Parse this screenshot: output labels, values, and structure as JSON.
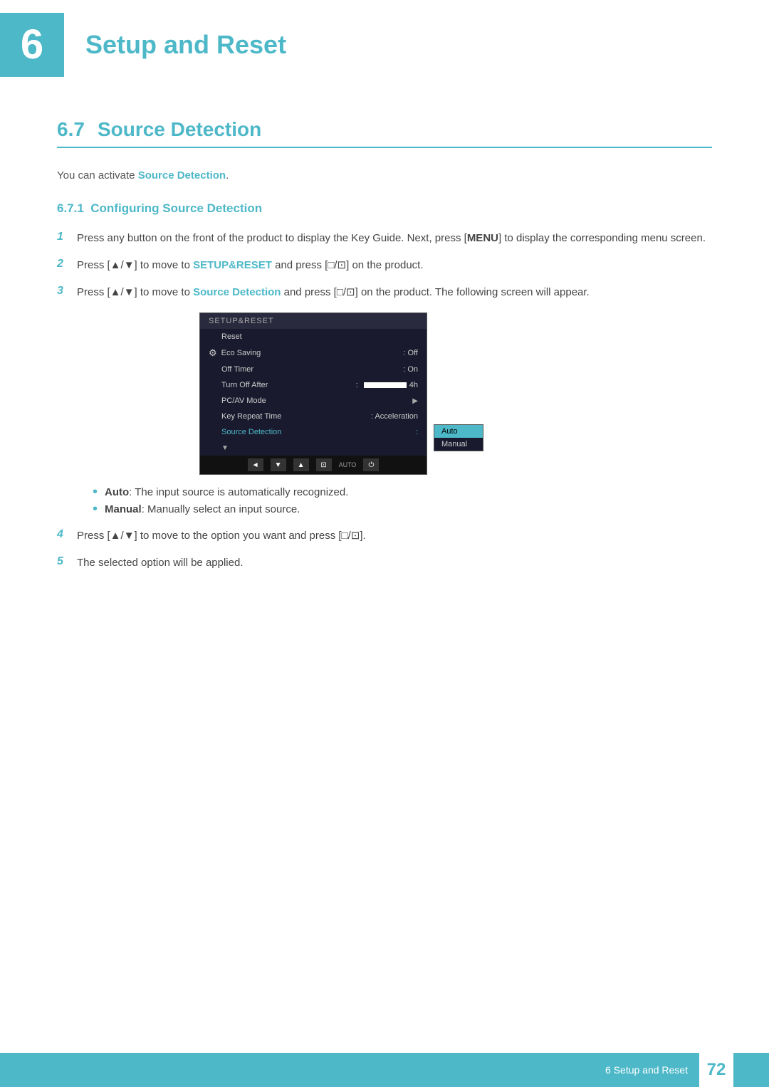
{
  "chapter": {
    "number": "6",
    "title": "Setup and Reset"
  },
  "section": {
    "number": "6.7",
    "title": "Source Detection"
  },
  "intro": {
    "prefix": "You can activate ",
    "highlight": "Source Detection",
    "suffix": "."
  },
  "subsection": {
    "number": "6.7.1",
    "title": "Configuring Source Detection"
  },
  "steps": [
    {
      "number": "1",
      "text_parts": [
        {
          "text": "Press any button on the front of the product to display the Key Guide. Next, press [",
          "type": "normal"
        },
        {
          "text": "MENU",
          "type": "bold"
        },
        {
          "text": "] to display the corresponding menu screen.",
          "type": "normal"
        }
      ]
    },
    {
      "number": "2",
      "text_parts": [
        {
          "text": "Press [▲/▼] to move to ",
          "type": "normal"
        },
        {
          "text": "SETUP&RESET",
          "type": "teal-bold"
        },
        {
          "text": " and press [□/⊡] on the product.",
          "type": "normal"
        }
      ]
    },
    {
      "number": "3",
      "text_parts": [
        {
          "text": "Press [▲/▼] to move to ",
          "type": "normal"
        },
        {
          "text": "Source Detection",
          "type": "teal-bold"
        },
        {
          "text": " and press [□/⊡] on the product. The following screen will appear.",
          "type": "normal"
        }
      ]
    }
  ],
  "menu": {
    "title": "SETUP&RESET",
    "items": [
      {
        "label": "Reset",
        "value": "",
        "type": "plain"
      },
      {
        "label": "Eco Saving",
        "value": "Off",
        "type": "value"
      },
      {
        "label": "Off Timer",
        "value": "On",
        "type": "value"
      },
      {
        "label": "Turn Off After",
        "value": "bar",
        "bar_label": "4h",
        "type": "bar"
      },
      {
        "label": "PC/AV Mode",
        "value": "",
        "type": "arrow"
      },
      {
        "label": "Key Repeat Time",
        "value": "Acceleration",
        "type": "value"
      },
      {
        "label": "Source Detection",
        "value": "",
        "type": "submenu",
        "active": true
      }
    ],
    "submenu_items": [
      {
        "label": "Auto",
        "selected": true
      },
      {
        "label": "Manual",
        "selected": false
      }
    ],
    "nav_buttons": [
      "◄",
      "▼",
      "▲",
      "⊡",
      "AUTO",
      "⏻"
    ]
  },
  "step4": {
    "number": "4",
    "text": "Press [▲/▼] to move to the option you want and press [□/⊡]."
  },
  "step5": {
    "number": "5",
    "text": "The selected option will be applied."
  },
  "bullets": [
    {
      "label": "Auto",
      "suffix": ": The input source is automatically recognized."
    },
    {
      "label": "Manual",
      "suffix": ": Manually select an input source."
    }
  ],
  "footer": {
    "section_label": "6 Setup and Reset",
    "page_number": "72"
  }
}
